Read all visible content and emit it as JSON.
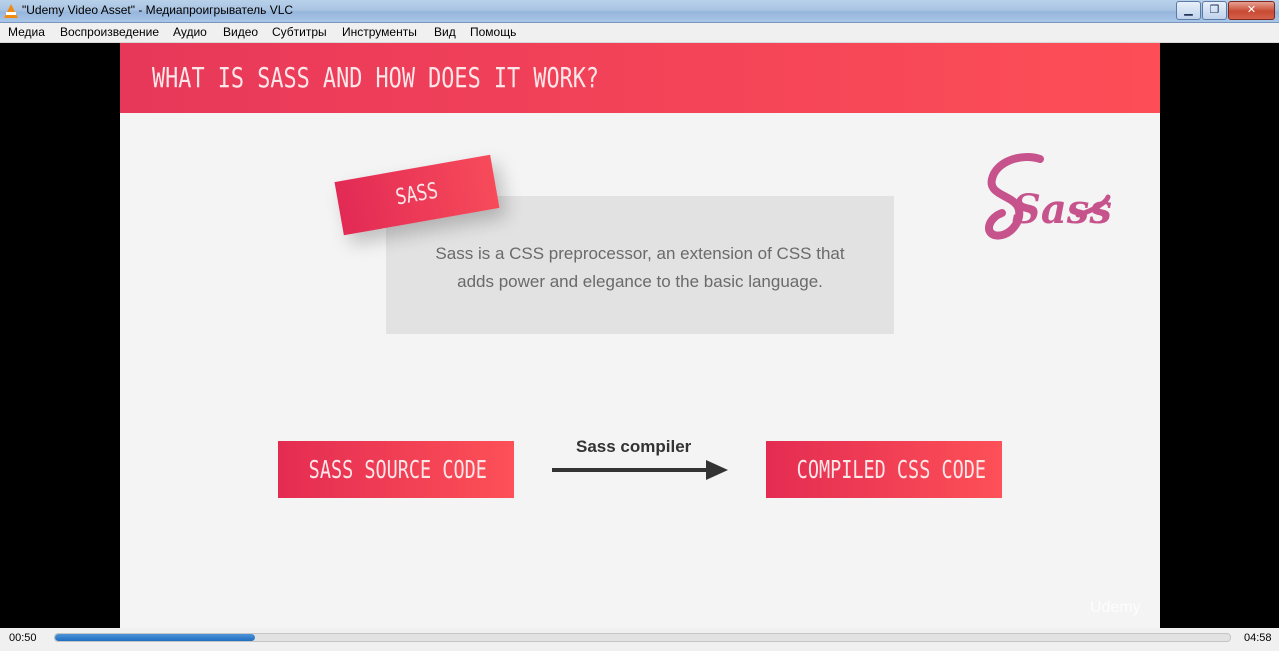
{
  "window": {
    "title": "\"Udemy Video Asset\" - Медиапроигрыватель VLC",
    "app_icon": "vlc-cone-icon",
    "controls": {
      "minimize": "minimize-icon",
      "maximize": "restore-icon",
      "close": "close-icon"
    }
  },
  "menu": {
    "items": [
      "Медиа",
      "Воспроизведение",
      "Аудио",
      "Видео",
      "Субтитры",
      "Инструменты",
      "Вид",
      "Помощь"
    ]
  },
  "slide": {
    "title": "WHAT IS SASS AND HOW DOES IT WORK?",
    "tag_label": "SASS",
    "definition_line1": "Sass is a CSS preprocessor, an extension of CSS that",
    "definition_line2": "adds power and elegance to the basic language.",
    "logo_text": "Sass",
    "source_label": "SASS SOURCE CODE",
    "compiler_label": "Sass compiler",
    "output_label": "COMPILED CSS CODE",
    "watermark": "Udemy"
  },
  "playback": {
    "elapsed": "00:50",
    "total": "04:58",
    "progress": 0.17
  },
  "colors": {
    "accent_red": "#e8385a",
    "sass_pink": "#c6538c",
    "progress_blue": "#2a7bcf"
  }
}
